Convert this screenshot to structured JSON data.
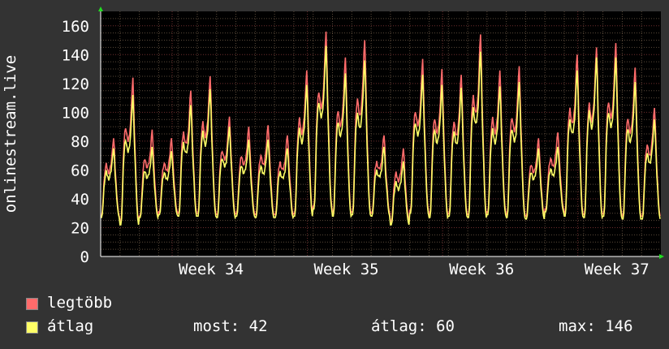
{
  "colors": {
    "background": "#333333",
    "plot_bg": "#000000",
    "grid_minor": "#5a4a3a",
    "grid_major": "#6e2e2e",
    "max_series": "#ff6b6b",
    "avg_series": "#ffff66",
    "text": "#ffffff"
  },
  "legend": {
    "max_label": "legtöbb",
    "avg_label": "átlag"
  },
  "stats": {
    "current": "most: 42",
    "average": "átlag: 60",
    "maximum": "max: 146"
  },
  "chart_data": {
    "type": "line",
    "title": "",
    "xlabel": "",
    "ylabel": "onlinestream.live",
    "ylim": [
      0,
      170
    ],
    "yticks": [
      0,
      20,
      40,
      60,
      80,
      100,
      120,
      140,
      160
    ],
    "x_tick_labels": [
      "Week 34",
      "Week 35",
      "Week 36",
      "Week 37"
    ],
    "grid": true,
    "legend_position": "bottom-left",
    "days": 29,
    "series": [
      {
        "name": "legtöbb",
        "daily_peaks": [
          82,
          124,
          88,
          82,
          115,
          125,
          97,
          90,
          91,
          84,
          129,
          156,
          138,
          150,
          84,
          75,
          137,
          130,
          126,
          154,
          129,
          132,
          82,
          86,
          140,
          145,
          148,
          131,
          103
        ],
        "daily_mins": [
          28,
          24,
          28,
          31,
          30,
          30,
          29,
          30,
          29,
          29,
          30,
          35,
          30,
          31,
          30,
          24,
          32,
          29,
          30,
          29,
          31,
          29,
          28,
          33,
          30,
          29,
          30,
          28,
          28
        ]
      },
      {
        "name": "átlag",
        "daily_peaks": [
          75,
          112,
          76,
          73,
          105,
          116,
          90,
          81,
          81,
          75,
          119,
          146,
          127,
          136,
          76,
          66,
          126,
          119,
          117,
          142,
          118,
          121,
          75,
          76,
          129,
          138,
          138,
          121,
          95
        ],
        "daily_mins": [
          27,
          22,
          27,
          29,
          28,
          28,
          27,
          28,
          27,
          27,
          28,
          33,
          28,
          29,
          28,
          22,
          30,
          27,
          28,
          27,
          29,
          27,
          26,
          31,
          28,
          27,
          28,
          26,
          26
        ]
      }
    ]
  }
}
